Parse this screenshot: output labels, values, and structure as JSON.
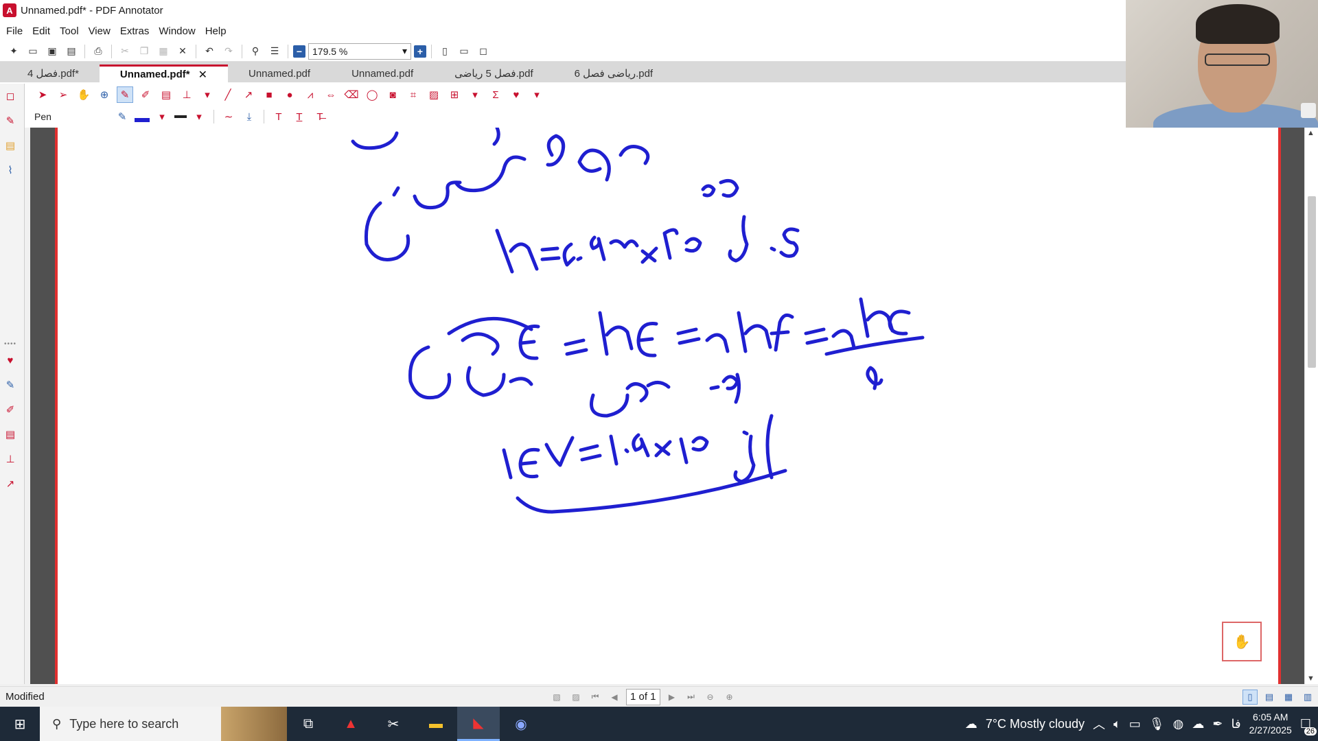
{
  "app": {
    "title": "Unnamed.pdf* - PDF Annotator",
    "logo": "A"
  },
  "menu": [
    "File",
    "Edit",
    "Tool",
    "View",
    "Extras",
    "Window",
    "Help"
  ],
  "toolbar": {
    "zoom": "179.5 %"
  },
  "tabs": [
    {
      "label": "فصل 4.pdf*",
      "active": false
    },
    {
      "label": "Unnamed.pdf*",
      "active": true
    },
    {
      "label": "Unnamed.pdf",
      "active": false
    },
    {
      "label": "Unnamed.pdf",
      "active": false
    },
    {
      "label": "فصل 5 رياضی.pdf",
      "active": false
    },
    {
      "label": "رياضی فصل 6.pdf",
      "active": false
    }
  ],
  "annotation": {
    "tool_name": "Pen",
    "pen_color": "#1f1fd0"
  },
  "statusbar": {
    "status": "Modified",
    "page": "1 of 1"
  },
  "taskbar": {
    "search_placeholder": "Type here to search",
    "weather": "7°C  Mostly cloudy",
    "lang": "فا",
    "time": "6:05 AM",
    "date": "2/27/2025",
    "notifications": "26"
  },
  "colors": {
    "accent": "#c8102e",
    "ink": "#1f1fd0",
    "page_border": "#e03030"
  }
}
